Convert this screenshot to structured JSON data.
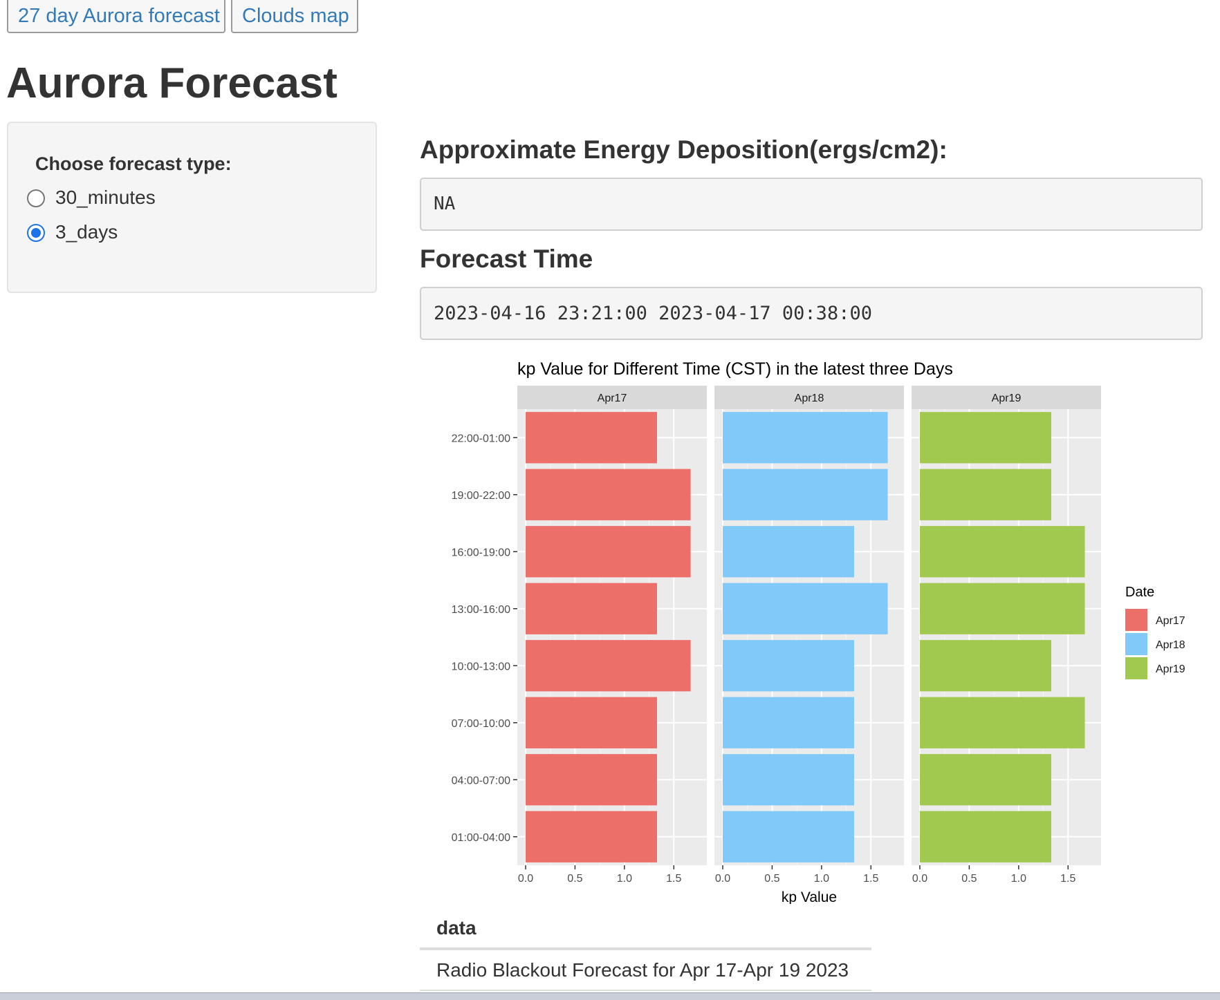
{
  "nav": {
    "aurora_27_label": "27 day Aurora forecast",
    "clouds_label": "Clouds map"
  },
  "page_title": "Aurora Forecast",
  "sidebar": {
    "label": "Choose forecast type:",
    "options": [
      {
        "label": "30_minutes",
        "checked": false
      },
      {
        "label": "3_days",
        "checked": true
      }
    ]
  },
  "energy": {
    "heading": "Approximate Energy Deposition(ergs/cm2):",
    "value": "NA"
  },
  "forecast_time": {
    "heading": "Forecast Time",
    "value": "2023-04-16 23:21:00 2023-04-17 00:38:00"
  },
  "chart_data": {
    "type": "bar",
    "orientation": "horizontal",
    "faceted": true,
    "title": "kp Value for Different Time (CST) in the latest three Days",
    "xlabel": "kp Value",
    "ylabel": "",
    "xlim": [
      0,
      1.75
    ],
    "xticks": [
      "0.0",
      "0.5",
      "1.0",
      "1.5"
    ],
    "categories": [
      "01:00-04:00",
      "04:00-07:00",
      "07:00-10:00",
      "10:00-13:00",
      "13:00-16:00",
      "16:00-19:00",
      "19:00-22:00",
      "22:00-01:00"
    ],
    "series": [
      {
        "name": "Apr17",
        "color": "#ed6f6a",
        "values": [
          1.33,
          1.33,
          1.33,
          1.67,
          1.33,
          1.67,
          1.67,
          1.33
        ]
      },
      {
        "name": "Apr18",
        "color": "#80c9f8",
        "values": [
          1.33,
          1.33,
          1.33,
          1.33,
          1.67,
          1.33,
          1.67,
          1.67
        ]
      },
      {
        "name": "Apr19",
        "color": "#a2c94f",
        "values": [
          1.33,
          1.33,
          1.67,
          1.33,
          1.67,
          1.67,
          1.33,
          1.33
        ]
      }
    ],
    "legend": {
      "title": "Date",
      "position": "right"
    },
    "grid": true
  },
  "table": {
    "header": "data",
    "rows": [
      "Radio Blackout Forecast for Apr 17-Apr 19 2023"
    ]
  }
}
